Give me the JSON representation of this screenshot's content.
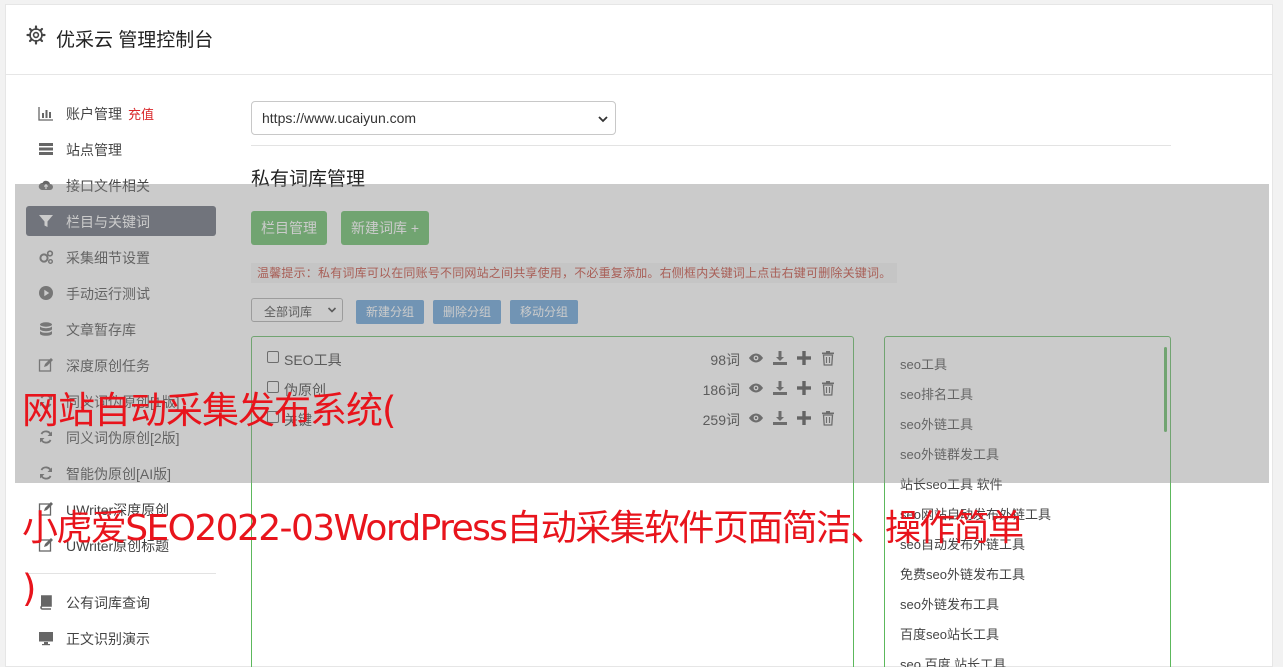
{
  "header": {
    "title": "优采云 管理控制台"
  },
  "sidebar": {
    "items": [
      {
        "label": "账户管理",
        "tag": "充值",
        "icon": "bar-chart-icon"
      },
      {
        "label": "站点管理",
        "icon": "server-icon"
      },
      {
        "label": "接口文件相关",
        "icon": "cloud-upload-icon"
      },
      {
        "label": "栏目与关键词",
        "icon": "filter-icon",
        "active": true
      },
      {
        "label": "采集细节设置",
        "icon": "cogs-icon"
      },
      {
        "label": "手动运行测试",
        "icon": "play-circle-icon"
      },
      {
        "label": "文章暂存库",
        "icon": "database-icon"
      },
      {
        "label": "深度原创任务",
        "icon": "edit-icon"
      },
      {
        "label": "同义词伪原创[1版]",
        "icon": "refresh-icon"
      },
      {
        "label": "同义词伪原创[2版]",
        "icon": "refresh-icon"
      },
      {
        "label": "智能伪原创[AI版]",
        "icon": "refresh-icon"
      },
      {
        "label": "UWriter深度原创",
        "icon": "edit-icon"
      },
      {
        "label": "UWriter原创标题",
        "icon": "edit-icon"
      }
    ],
    "items2": [
      {
        "label": "公有词库查询",
        "icon": "book-icon"
      },
      {
        "label": "正文识别演示",
        "icon": "monitor-icon"
      }
    ]
  },
  "site_select": {
    "value": "https://www.ucaiyun.com"
  },
  "section": {
    "title": "私有词库管理"
  },
  "buttons": {
    "column_manage": "栏目管理",
    "new_library": "新建词库 +"
  },
  "tip": "温馨提示：私有词库可以在同账号不同网站之间共享使用，不必重复添加。右侧框内关键词上点击右键可删除关键词。",
  "group_select": {
    "value": "全部词库"
  },
  "group_buttons": {
    "new_group": "新建分组",
    "delete_group": "删除分组",
    "move_group": "移动分组"
  },
  "libraries": [
    {
      "name": "SEO工具",
      "count": "98词"
    },
    {
      "name": "伪原创",
      "count": "186词"
    },
    {
      "name": "关键",
      "count": "259词"
    }
  ],
  "keywords": [
    "seo工具",
    "seo排名工具",
    "seo外链工具",
    "seo外链群发工具",
    "站长seo工具 软件",
    "seo网站自动发布外链工具",
    "seo自动发布外链工具",
    "免费seo外链发布工具",
    "seo外链发布工具",
    "百度seo站长工具",
    "seo 百度 站长工具"
  ],
  "watermark": {
    "line1": "网站自动采集发布系统(",
    "line2": "小虎爱SEO2022-03WordPress自动采集软件页面简洁、操作简单",
    "line3": ")"
  },
  "colors": {
    "accent_green": "#5cb85c",
    "accent_blue": "#5b9bd5",
    "sidebar_active": "#5b6270",
    "watermark_red": "#e8141c"
  }
}
